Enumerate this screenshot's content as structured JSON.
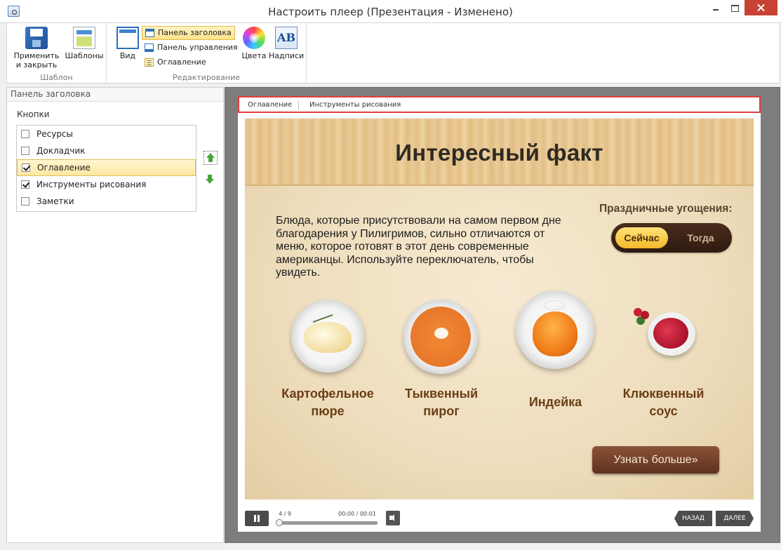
{
  "window": {
    "title": "Настроить плеер (Презентация - Изменено)"
  },
  "ribbon": {
    "apply_label": "Применить и закрыть",
    "templates_label": "Шаблоны",
    "group_template": "Шаблон",
    "view_label": "Вид",
    "title_panel_label": "Панель заголовка",
    "control_panel_label": "Панель управления",
    "toc_label": "Оглавление",
    "colors_label": "Цвета",
    "labels_label": "Надписи",
    "labels_icon_text": "AB",
    "group_editing": "Редактирование"
  },
  "left_panel": {
    "header": "Панель заголовка",
    "section": "Кнопки",
    "items": [
      {
        "label": "Ресурсы",
        "checked": false
      },
      {
        "label": "Докладчик",
        "checked": false
      },
      {
        "label": "Оглавление",
        "checked": true,
        "selected": true
      },
      {
        "label": "Инструменты рисования",
        "checked": true
      },
      {
        "label": "Заметки",
        "checked": false
      }
    ]
  },
  "player": {
    "topbar": {
      "item1": "Оглавление",
      "item2": "Инструменты рисования"
    },
    "slide": {
      "title": "Интересный факт",
      "body_lines": [
        "Блюда, которые  присутствовали на самом первом дне",
        "благодарения  у Пилигримов,  сильно отличаются от",
        "меню, которое  готовят в этот день современные",
        "американцы.  Используйте переключатель, чтобы",
        "увидеть."
      ],
      "holiday_label": "Праздничные угощения:",
      "toggle_now": "Сейчас",
      "toggle_then": "Тогда",
      "foods": [
        {
          "line1": "Картофельное",
          "line2": "пюре"
        },
        {
          "line1": "Тыквенный",
          "line2": "пирог"
        },
        {
          "line1": "Индейка",
          "line2": ""
        },
        {
          "line1": "Клюквенный",
          "line2": "соус"
        }
      ],
      "more_button": "Узнать больше»"
    },
    "controls": {
      "slide_counter": "4  / 9",
      "time": "00:00  / 00:01",
      "prev": "НАЗАД",
      "next": "ДАЛЕЕ"
    }
  }
}
